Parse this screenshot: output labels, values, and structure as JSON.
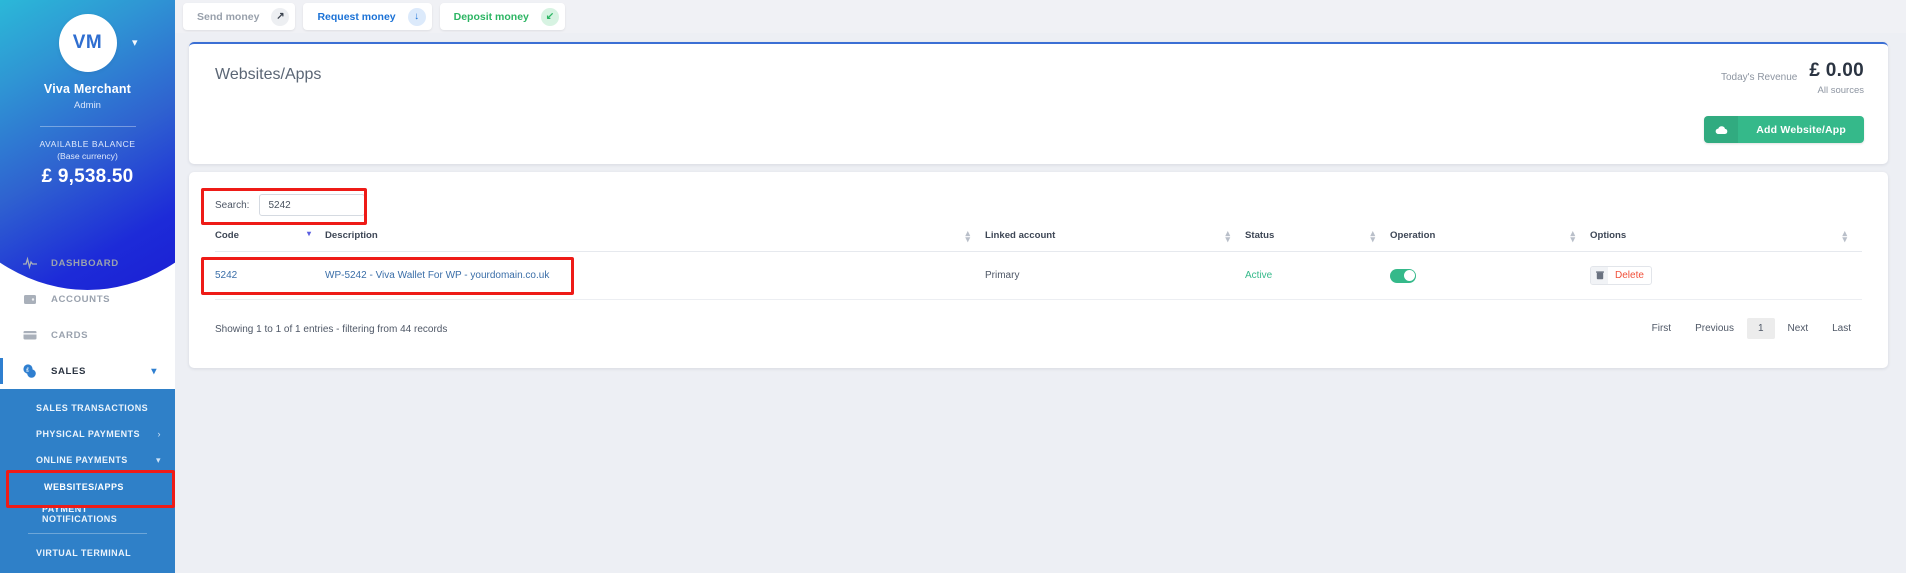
{
  "topbar": {
    "buttons": [
      {
        "label": "Send money",
        "icon": "arrow-up-right-icon",
        "glyph": "↗",
        "style": "grey"
      },
      {
        "label": "Request money",
        "icon": "arrow-down-icon",
        "glyph": "↓",
        "style": "blue"
      },
      {
        "label": "Deposit money",
        "icon": "arrow-down-left-icon",
        "glyph": "↙",
        "style": "green"
      }
    ]
  },
  "sidebar": {
    "avatar_initials": "VM",
    "caret_icon": "chevron-down-icon",
    "profile_name": "Viva Merchant",
    "profile_role": "Admin",
    "balance_label": "AVAILABLE BALANCE",
    "balance_sub": "(Base currency)",
    "balance_amount": "£ 9,538.50",
    "nav": [
      {
        "label": "DASHBOARD",
        "icon": "pulse-icon"
      },
      {
        "label": "ACCOUNTS",
        "icon": "wallet-icon"
      },
      {
        "label": "CARDS",
        "icon": "card-icon"
      },
      {
        "label": "SALES",
        "icon": "sales-icon",
        "chevron": "∨"
      }
    ],
    "submenu": [
      {
        "label": "SALES TRANSACTIONS"
      },
      {
        "label": "PHYSICAL PAYMENTS",
        "arrow": "›"
      },
      {
        "label": "ONLINE PAYMENTS",
        "arrow": "∨"
      },
      {
        "label": "WEBSITES/APPS",
        "selected": true
      },
      {
        "label": "PAYMENT NOTIFICATIONS"
      },
      {
        "label": "VIRTUAL TERMINAL"
      }
    ]
  },
  "header": {
    "title": "Websites/Apps",
    "revenue_label": "Today's Revenue",
    "revenue_amount": "£ 0.00",
    "revenue_sub": "All sources",
    "add_button_label": "Add Website/App",
    "add_button_icon": "cloud-icon"
  },
  "table": {
    "search_label": "Search:",
    "search_value": "5242",
    "search_placeholder": "",
    "columns": [
      {
        "label": "Code",
        "sorted": true
      },
      {
        "label": "Description",
        "sorted": false
      },
      {
        "label": "Linked account",
        "sorted": false
      },
      {
        "label": "Status",
        "sorted": false
      },
      {
        "label": "Operation",
        "sorted": false
      },
      {
        "label": "Options",
        "sorted": false
      },
      {
        "label": "",
        "sorted": false
      }
    ],
    "rows": [
      {
        "code": "5242",
        "description": "WP-5242 - Viva Wallet For WP - yourdomain.co.uk",
        "linked_account": "Primary",
        "status": "Active",
        "operation_toggle": "on",
        "options_label": "Delete",
        "options_icon": "trash-icon"
      }
    ],
    "footer_text": "Showing 1 to 1 of 1 entries - filtering from 44 records",
    "pagination": [
      {
        "label": "First",
        "current": false
      },
      {
        "label": "Previous",
        "current": false
      },
      {
        "label": "1",
        "current": true
      },
      {
        "label": "Next",
        "current": false
      },
      {
        "label": "Last",
        "current": false
      }
    ]
  },
  "colors": {
    "accent_blue": "#2f80c8",
    "brand_green": "#35b98a",
    "highlight_red": "#ee1b17",
    "status_active": "#35b98a",
    "delete_red": "#f0503a"
  }
}
